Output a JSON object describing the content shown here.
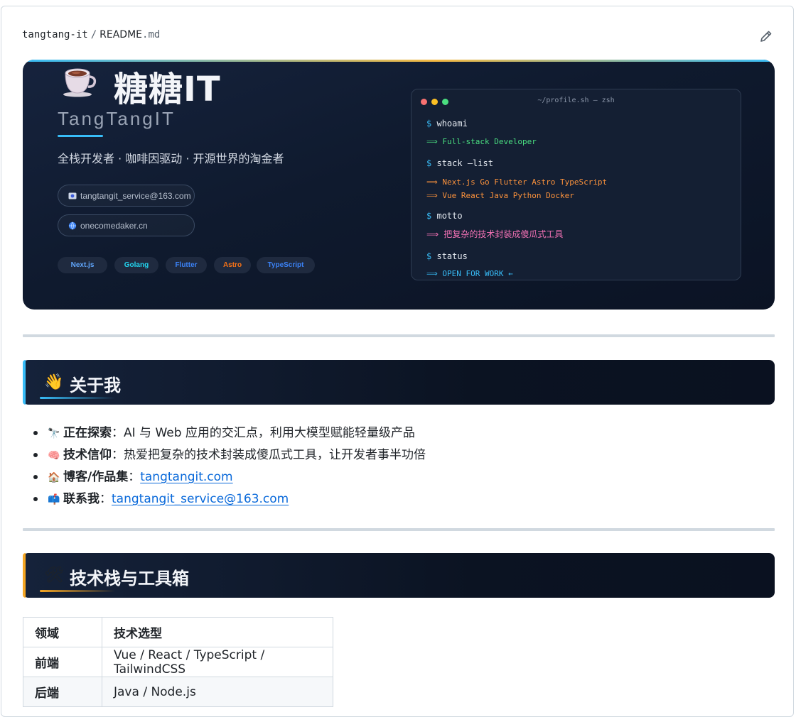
{
  "file_header": {
    "repo": "tangtang-it",
    "separator": "/",
    "file_name": "README",
    "file_ext": ".md",
    "edit_icon": "pencil-icon"
  },
  "banner": {
    "cup_icon": "coffee-cup-icon",
    "title": "糖糖IT",
    "subtitle": "TangTangIT",
    "tagline": "全栈开发者 · 咖啡因驱动 · 开源世界的淘金者",
    "email_icon": "mail-icon",
    "email": "tangtangit_service@163.com",
    "website_icon": "globe-icon",
    "website": "onecomedaker.cn",
    "badges": [
      {
        "label": "Next.js",
        "color": "#60a5fa"
      },
      {
        "label": "Golang",
        "color": "#22d3ee"
      },
      {
        "label": "Flutter",
        "color": "#3b82f6"
      },
      {
        "label": "Astro",
        "color": "#f97316"
      },
      {
        "label": "TypeScript",
        "color": "#3b82f6"
      }
    ],
    "terminal": {
      "title": "~/profile.sh — zsh",
      "prompt": "$",
      "cmd_whoami": "whoami",
      "out_whoami": "⟹ Full-stack Developer",
      "cmd_stack": "stack —list",
      "out_stack_1": "⟹ Next.js Go Flutter Astro TypeScript",
      "out_stack_2": "⟹ Vue React Java Python Docker",
      "cmd_motto": "motto",
      "out_motto": "⟹ 把复杂的技术封装成傻瓜式工具",
      "cmd_status": "status",
      "out_status": "⟹ OPEN FOR WORK ←",
      "colors": {
        "green": "#4ade80",
        "orange": "#fb923c",
        "pink": "#f472b6",
        "blue": "#38bdf8"
      }
    }
  },
  "about": {
    "emoji": "👋",
    "title": "关于我",
    "accent": "#38bdf8",
    "items": [
      {
        "emoji": "🔭",
        "key": "正在探索",
        "sep": "：",
        "text": "AI 与 Web 应用的交汇点，利用大模型赋能轻量级产品"
      },
      {
        "emoji": "🧠",
        "key": "技术信仰",
        "sep": "：",
        "text": "热爱把复杂的技术封装成傻瓜式工具，让开发者事半功倍"
      },
      {
        "emoji": "🏠",
        "key": "博客/作品集",
        "sep": "：",
        "link": "tangtangit.com"
      },
      {
        "emoji": "📫",
        "key": "联系我",
        "sep": "：",
        "link": "tangtangit_service@163.com"
      }
    ]
  },
  "stack": {
    "emoji": "🛠",
    "title": "技术栈与工具箱",
    "accent": "#f5a623",
    "table": {
      "headers": [
        "领域",
        "技术选型"
      ],
      "rows": [
        [
          "前端",
          "Vue / React / TypeScript / TailwindCSS"
        ],
        [
          "后端",
          "Java / Node.js"
        ]
      ]
    }
  }
}
